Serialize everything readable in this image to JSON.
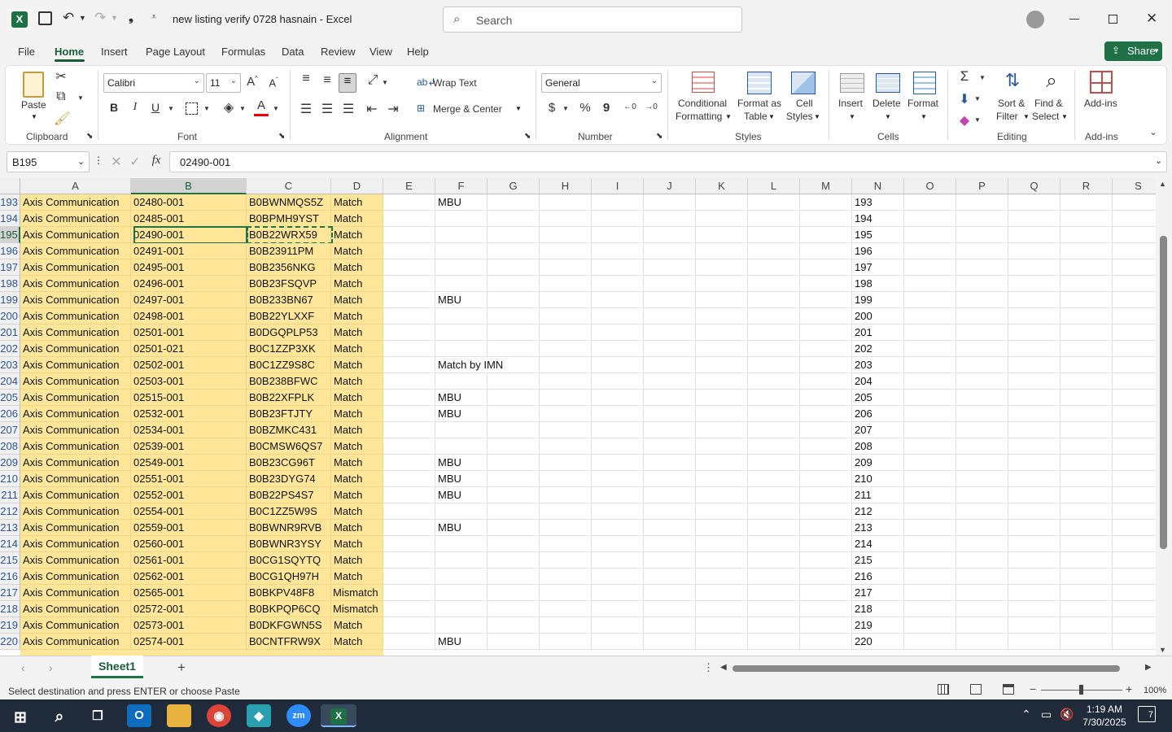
{
  "window": {
    "title": "new listing verify 0728 hasnain  -  Excel",
    "search_placeholder": "Search"
  },
  "menu": {
    "tabs": [
      "File",
      "Home",
      "Insert",
      "Page Layout",
      "Formulas",
      "Data",
      "Review",
      "View",
      "Help"
    ],
    "active_tab": "Home",
    "share_label": "Share"
  },
  "ribbon": {
    "clipboard": {
      "paste_label": "Paste",
      "group_label": "Clipboard"
    },
    "font": {
      "family": "Calibri",
      "size": "11",
      "group_label": "Font",
      "bold": "B",
      "italic": "I",
      "underline": "U"
    },
    "alignment": {
      "wrap_text": "Wrap Text",
      "merge_center": "Merge & Center",
      "group_label": "Alignment"
    },
    "number": {
      "format": "General",
      "currency": "$",
      "percent": "%",
      "comma": "9",
      "group_label": "Number"
    },
    "styles": {
      "conditional_1": "Conditional",
      "conditional_2": "Formatting",
      "format_table_1": "Format as",
      "format_table_2": "Table",
      "cell_styles_1": "Cell",
      "cell_styles_2": "Styles",
      "group_label": "Styles"
    },
    "cells": {
      "insert": "Insert",
      "delete": "Delete",
      "format": "Format",
      "group_label": "Cells"
    },
    "editing": {
      "sort_filter_1": "Sort &",
      "sort_filter_2": "Filter",
      "find_select_1": "Find &",
      "find_select_2": "Select",
      "group_label": "Editing"
    },
    "addins": {
      "addins": "Add-ins",
      "group_label": "Add-ins"
    }
  },
  "formula_bar": {
    "name_box": "B195",
    "fx": "fx",
    "value": "02490-001"
  },
  "grid": {
    "columns": [
      "A",
      "B",
      "C",
      "D",
      "E",
      "F",
      "G",
      "H",
      "I",
      "J",
      "K",
      "L",
      "M",
      "N",
      "O",
      "P",
      "Q",
      "R",
      "S"
    ],
    "selected_column": "B",
    "selected_row": "195",
    "rows": [
      {
        "n": "193",
        "a": "Axis Communication",
        "b": "02480-001",
        "c": "B0BWNMQS5Z",
        "d": "Match",
        "f": "MBU"
      },
      {
        "n": "194",
        "a": "Axis Communication",
        "b": "02485-001",
        "c": "B0BPMH9YST",
        "d": "Match",
        "f": ""
      },
      {
        "n": "195",
        "a": "Axis Communication",
        "b": "02490-001",
        "c": "B0B22WRX59",
        "d": "Match",
        "f": ""
      },
      {
        "n": "196",
        "a": "Axis Communication",
        "b": "02491-001",
        "c": "B0B23911PM",
        "d": "Match",
        "f": ""
      },
      {
        "n": "197",
        "a": "Axis Communication",
        "b": "02495-001",
        "c": "B0B2356NKG",
        "d": "Match",
        "f": ""
      },
      {
        "n": "198",
        "a": "Axis Communication",
        "b": "02496-001",
        "c": "B0B23FSQVP",
        "d": "Match",
        "f": ""
      },
      {
        "n": "199",
        "a": "Axis Communication",
        "b": "02497-001",
        "c": "B0B233BN67",
        "d": "Match",
        "f": "MBU"
      },
      {
        "n": "200",
        "a": "Axis Communication",
        "b": "02498-001",
        "c": "B0B22YLXXF",
        "d": "Match",
        "f": ""
      },
      {
        "n": "201",
        "a": "Axis Communication",
        "b": "02501-001",
        "c": "B0DGQPLP53",
        "d": "Match",
        "f": ""
      },
      {
        "n": "202",
        "a": "Axis Communication",
        "b": "02501-021",
        "c": "B0C1ZZP3XK",
        "d": "Match",
        "f": ""
      },
      {
        "n": "203",
        "a": "Axis Communication",
        "b": "02502-001",
        "c": "B0C1ZZ9S8C",
        "d": "Match",
        "f": "Match by IMN"
      },
      {
        "n": "204",
        "a": "Axis Communication",
        "b": "02503-001",
        "c": "B0B238BFWC",
        "d": "Match",
        "f": ""
      },
      {
        "n": "205",
        "a": "Axis Communication",
        "b": "02515-001",
        "c": "B0B22XFPLK",
        "d": "Match",
        "f": "MBU"
      },
      {
        "n": "206",
        "a": "Axis Communication",
        "b": "02532-001",
        "c": "B0B23FTJTY",
        "d": "Match",
        "f": "MBU"
      },
      {
        "n": "207",
        "a": "Axis Communication",
        "b": "02534-001",
        "c": "B0BZMKC431",
        "d": "Match",
        "f": ""
      },
      {
        "n": "208",
        "a": "Axis Communication",
        "b": "02539-001",
        "c": "B0CMSW6QS7",
        "d": "Match",
        "f": ""
      },
      {
        "n": "209",
        "a": "Axis Communication",
        "b": "02549-001",
        "c": "B0B23CG96T",
        "d": "Match",
        "f": "MBU"
      },
      {
        "n": "210",
        "a": "Axis Communication",
        "b": "02551-001",
        "c": "B0B23DYG74",
        "d": "Match",
        "f": "MBU"
      },
      {
        "n": "211",
        "a": "Axis Communication",
        "b": "02552-001",
        "c": "B0B22PS4S7",
        "d": "Match",
        "f": "MBU"
      },
      {
        "n": "212",
        "a": "Axis Communication",
        "b": "02554-001",
        "c": "B0C1ZZ5W9S",
        "d": "Match",
        "f": ""
      },
      {
        "n": "213",
        "a": "Axis Communication",
        "b": "02559-001",
        "c": "B0BWNR9RVB",
        "d": "Match",
        "f": "MBU"
      },
      {
        "n": "214",
        "a": "Axis Communication",
        "b": "02560-001",
        "c": "B0BWNR3YSY",
        "d": "Match",
        "f": ""
      },
      {
        "n": "215",
        "a": "Axis Communication",
        "b": "02561-001",
        "c": "B0CG1SQYTQ",
        "d": "Match",
        "f": ""
      },
      {
        "n": "216",
        "a": "Axis Communication",
        "b": "02562-001",
        "c": "B0CG1QH97H",
        "d": "Match",
        "f": ""
      },
      {
        "n": "217",
        "a": "Axis Communication",
        "b": "02565-001",
        "c": "B0BKPV48F8",
        "d": "Mismatch",
        "f": ""
      },
      {
        "n": "218",
        "a": "Axis Communication",
        "b": "02572-001",
        "c": "B0BKPQP6CQ",
        "d": "Mismatch",
        "f": ""
      },
      {
        "n": "219",
        "a": "Axis Communication",
        "b": "02573-001",
        "c": "B0DKFGWN5S",
        "d": "Match",
        "f": ""
      },
      {
        "n": "220",
        "a": "Axis Communication",
        "b": "02574-001",
        "c": "B0CNTFRW9X",
        "d": "Match",
        "f": "MBU"
      }
    ]
  },
  "sheet_tabs": {
    "active": "Sheet1",
    "add": "+"
  },
  "status": {
    "message": "Select destination and press ENTER or choose Paste",
    "zoom": "100%"
  },
  "taskbar": {
    "time": "1:19 AM",
    "date": "7/30/2025",
    "notification_count": "7"
  },
  "colors": {
    "accent": "#217346",
    "highlight_fill": "#ffe699",
    "row_number": "#2b5797"
  }
}
